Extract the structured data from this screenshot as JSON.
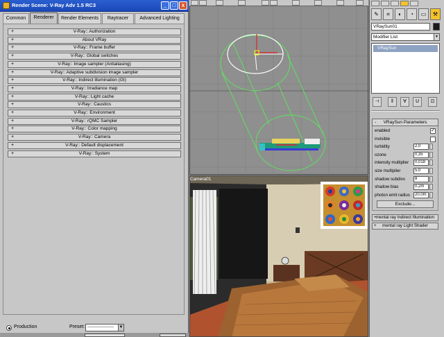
{
  "dialog": {
    "title": "Render Scene: V-Ray Adv 1.5 RC3",
    "tabs": [
      "Common",
      "Renderer",
      "Render Elements",
      "Raytracer",
      "Advanced Lighting"
    ],
    "active_tab": "Renderer",
    "rollouts": [
      "V-Ray:: Authorization",
      "About VRay",
      "V-Ray:: Frame buffer",
      "V-Ray:: Global switches",
      "V-Ray:: Image sampler (Antialiasing)",
      "V-Ray:: Adaptive subdivision image sampler",
      "V-Ray:: Indirect illumination (GI)",
      "V-Ray:: Irradiance map",
      "V-Ray:: Light cache",
      "V-Ray:: Caustics",
      "V-Ray:: Environment",
      "V-Ray:: rQMC Sampler",
      "V-Ray:: Color mapping",
      "V-Ray:: Camera",
      "V-Ray:: Default displacement",
      "V-Ray:: System"
    ],
    "rollout_prefix": "+",
    "production_label": "Production",
    "preset_label": "Preset:",
    "preset_value": "-------------------",
    "window_buttons": {
      "minimize": "_",
      "maximize": "□",
      "close": "x"
    }
  },
  "viewport_camera": {
    "label": "Camera01"
  },
  "command_panel": {
    "tabs": [
      "✎",
      "⌗",
      "◐",
      "◔",
      "▭",
      "⚒"
    ],
    "active_tab_index": 5,
    "object_name": "VRaySun01",
    "object_color": "#1a1a1a",
    "modifier_list": "Modifier List",
    "dropdown_arrow": "▼",
    "stack_item": "VRaySun",
    "stack_tools": [
      "⊣",
      "‖",
      "∀",
      "ᑌ",
      "⊡"
    ],
    "params_title": "VRaySun Parameters",
    "params_collapse": "-",
    "params": [
      {
        "label": "enabled",
        "type": "checkbox",
        "checked": true,
        "mark": "✓"
      },
      {
        "label": "invisible",
        "type": "checkbox",
        "checked": false,
        "mark": ""
      },
      {
        "label": "turbidity",
        "type": "spinner",
        "value": "2,0"
      },
      {
        "label": "ozone",
        "type": "spinner",
        "value": "0,35"
      },
      {
        "label": "intensity multiplier",
        "type": "spinner",
        "value": "0,018"
      },
      {
        "label": "size multiplier",
        "type": "spinner",
        "value": "5,0"
      },
      {
        "label": "shadow subdivs",
        "type": "spinner",
        "value": "8"
      },
      {
        "label": "shadow bias",
        "type": "spinner",
        "value": "0,2m"
      },
      {
        "label": "photon emit radius",
        "type": "spinner",
        "value": "20,0m"
      }
    ],
    "exclude_label": "Exclude...",
    "extra_rollouts": [
      "mental ray Indirect Illumination",
      "mental ray Light Shader"
    ],
    "extra_rollout_prefix": "+"
  },
  "colors": {
    "titlebar": "#1b48b8",
    "panel": "#c7c7c7",
    "selection": "#8ea2c2",
    "active_tab": "#f4c22c",
    "gizmo": "#5fe05f"
  }
}
